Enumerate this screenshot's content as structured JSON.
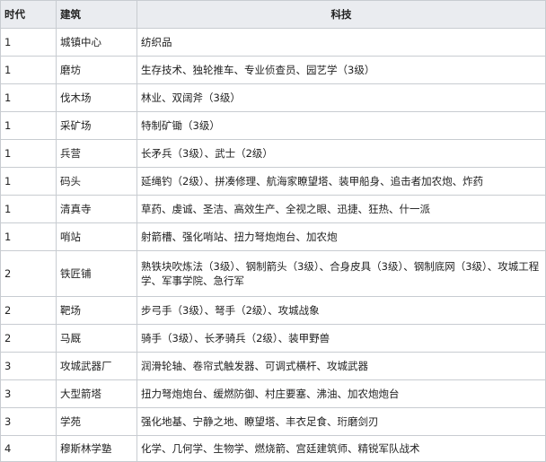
{
  "table": {
    "headers": [
      "时代",
      "建筑",
      "科技"
    ],
    "rows": [
      {
        "era": "1",
        "building": "城镇中心",
        "tech": "纺织品"
      },
      {
        "era": "1",
        "building": "磨坊",
        "tech": "生存技术、独轮推车、专业侦查员、园艺学（3级）"
      },
      {
        "era": "1",
        "building": "伐木场",
        "tech": "林业、双阔斧（3级）"
      },
      {
        "era": "1",
        "building": "采矿场",
        "tech": "特制矿锄（3级）"
      },
      {
        "era": "1",
        "building": "兵营",
        "tech": "长矛兵（3级）、武士（2级）"
      },
      {
        "era": "1",
        "building": "码头",
        "tech": "延绳钓（2级）、拼凑修理、航海家瞭望塔、装甲船身、追击者加农炮、炸药"
      },
      {
        "era": "1",
        "building": "清真寺",
        "tech": "草药、虔诚、圣洁、高效生产、全视之眼、迅捷、狂热、什一派"
      },
      {
        "era": "1",
        "building": "哨站",
        "tech": "射箭槽、强化哨站、扭力弩炮炮台、加农炮"
      },
      {
        "era": "2",
        "building": "铁匠铺",
        "tech": "熟铁块吹炼法（3级）、钢制箭头（3级）、合身皮具（3级）、钢制底网（3级）、攻城工程学、军事学院、急行军"
      },
      {
        "era": "2",
        "building": "靶场",
        "tech": "步弓手（3级）、弩手（2级）、攻城战象"
      },
      {
        "era": "2",
        "building": "马厩",
        "tech": "骑手（3级）、长矛骑兵（2级）、装甲野兽"
      },
      {
        "era": "3",
        "building": "攻城武器厂",
        "tech": "润滑轮轴、卷帘式触发器、可调式横杆、攻城武器"
      },
      {
        "era": "3",
        "building": "大型箭塔",
        "tech": "扭力弩炮炮台、缓燃防御、村庄要塞、沸油、加农炮炮台"
      },
      {
        "era": "3",
        "building": "学苑",
        "tech": "强化地基、宁静之地、瞭望塔、丰衣足食、珩磨剑刃"
      },
      {
        "era": "4",
        "building": "穆斯林学塾",
        "tech": "化学、几何学、生物学、燃烧箭、宫廷建筑师、精锐军队战术"
      }
    ]
  }
}
